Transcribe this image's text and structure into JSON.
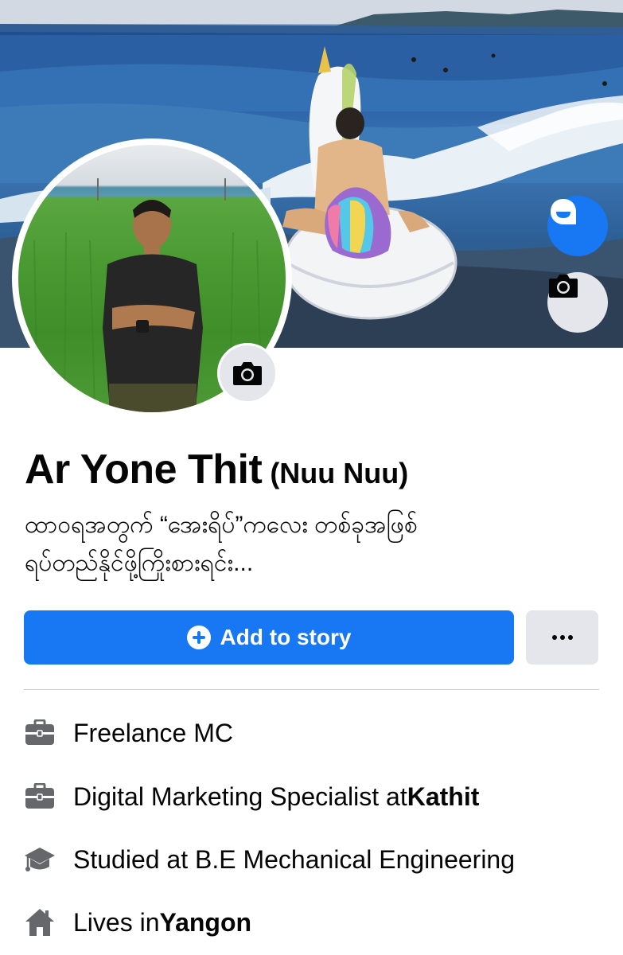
{
  "profile": {
    "name": "Ar Yone Thit",
    "alternate_name": "(Nuu Nuu)",
    "bio_line1": "ထာဝရအတွက် “အေးရိပ်”ကလေး တစ်ခုအဖြစ်",
    "bio_line2": "ရပ်တည်နိုင်ဖို့ကြိုးစားရင်း..."
  },
  "actions": {
    "add_to_story_label": "Add to story",
    "more_icon": "more-dots-icon"
  },
  "cover": {
    "avatar_button_icon": "avatar-icon",
    "camera_icon": "camera-icon"
  },
  "details": [
    {
      "icon": "briefcase-icon",
      "text": "Freelance MC",
      "bold": ""
    },
    {
      "icon": "briefcase-icon",
      "prefix": "Digital Marketing Specialist at ",
      "bold": "Kathit"
    },
    {
      "icon": "graduation-cap-icon",
      "text": "Studied at B.E Mechanical Engineering",
      "bold": ""
    },
    {
      "icon": "home-icon",
      "prefix": "Lives in ",
      "bold": "Yangon"
    }
  ],
  "colors": {
    "primary": "#1877f2",
    "secondary_button": "#e4e6eb",
    "text": "#050505",
    "icon_gray": "#65676b"
  }
}
